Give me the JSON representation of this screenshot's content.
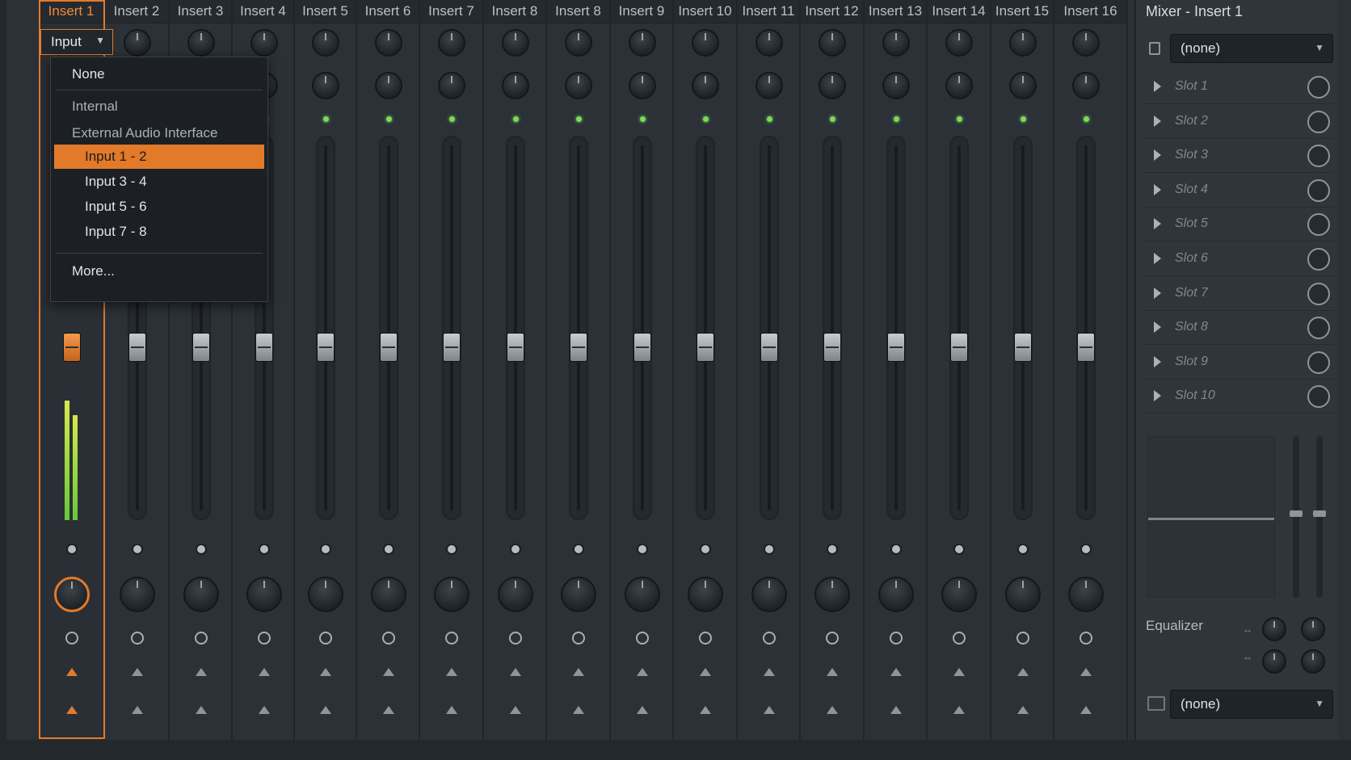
{
  "strips": [
    {
      "label": "Insert 1"
    },
    {
      "label": "Insert 2"
    },
    {
      "label": "Insert 3"
    },
    {
      "label": "Insert 4"
    },
    {
      "label": "Insert 5"
    },
    {
      "label": "Insert 6"
    },
    {
      "label": "Insert 7"
    },
    {
      "label": "Insert 8"
    },
    {
      "label": "Insert 8"
    },
    {
      "label": "Insert 9"
    },
    {
      "label": "Insert 10"
    },
    {
      "label": "Insert 11"
    },
    {
      "label": "Insert 12"
    },
    {
      "label": "Insert 13"
    },
    {
      "label": "Insert 14"
    },
    {
      "label": "Insert 15"
    },
    {
      "label": "Insert 16"
    }
  ],
  "input_selector": {
    "label": "Input"
  },
  "input_menu": {
    "none": "None",
    "internal": "Internal",
    "external": "External Audio Interface",
    "items": [
      "Input 1 - 2",
      "Input 3 - 4",
      "Input 5 - 6",
      "Input 7 - 8"
    ],
    "selected": "Input 1 - 2",
    "more": "More..."
  },
  "panel": {
    "title": "Mixer - Insert 1",
    "top_select": "(none)",
    "slots": [
      "Slot 1",
      "Slot 2",
      "Slot 3",
      "Slot 4",
      "Slot 5",
      "Slot 6",
      "Slot 7",
      "Slot 8",
      "Slot 9",
      "Slot 10"
    ],
    "eq_label": "Equalizer",
    "bottom_select": "(none)"
  },
  "colors": {
    "accent": "#e27a2a",
    "led": "#7ed957",
    "background": "#2b3137"
  }
}
